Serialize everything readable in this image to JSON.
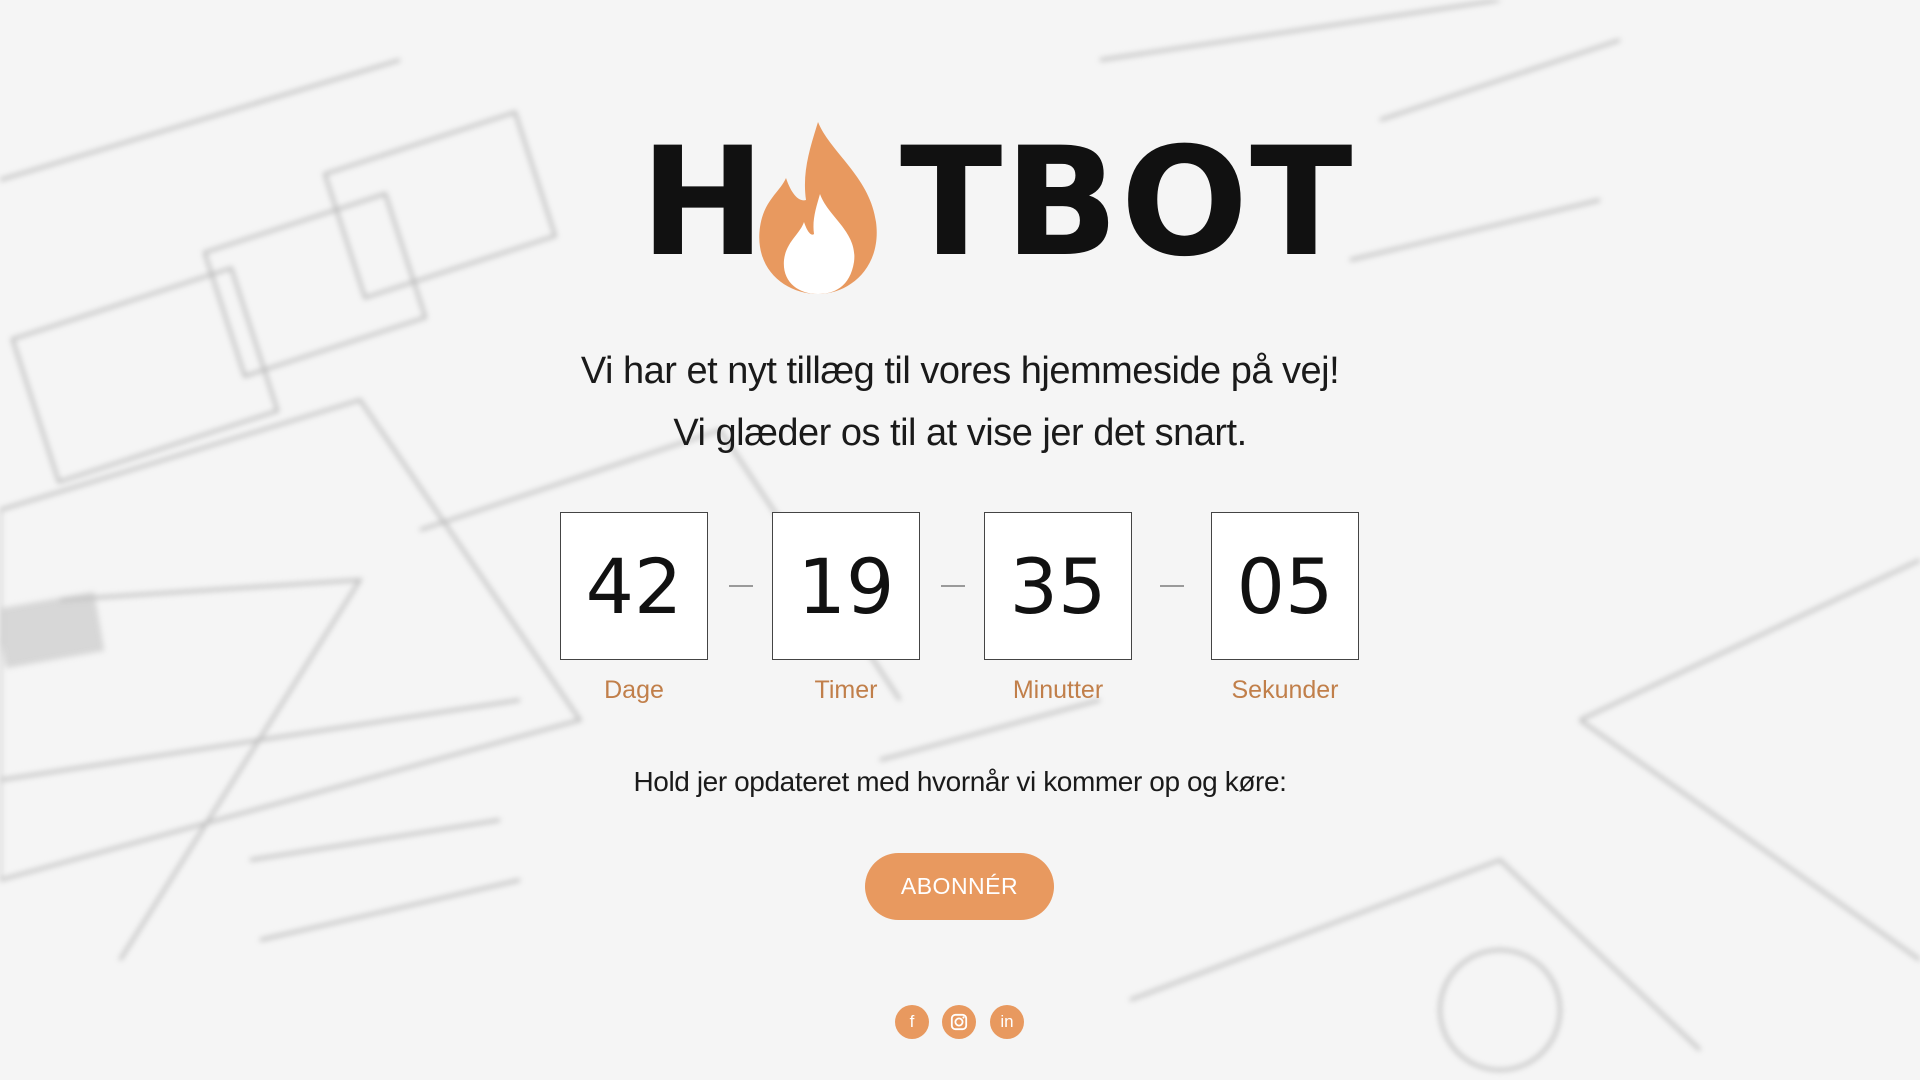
{
  "brand": {
    "logo_first": "H",
    "logo_rest": "TBOT",
    "logo_icon": "flame-icon",
    "accent_color": "#e8995f"
  },
  "headline": {
    "line1": "Vi har et nyt tillæg til vores hjemmeside på vej!",
    "line2": "Vi glæder os til at vise jer det snart."
  },
  "countdown": {
    "days": "42",
    "hours": "19",
    "minutes": "35",
    "seconds": "05",
    "days_label": "Dage",
    "hours_label": "Timer",
    "minutes_label": "Minutter",
    "seconds_label": "Sekunder"
  },
  "subscribe": {
    "prompt": "Hold jer opdateret med hvornår vi kommer op og køre:",
    "button_label": "ABONNÉR"
  },
  "social": {
    "facebook_glyph": "f",
    "linkedin_glyph": "in",
    "icons": [
      "facebook-icon",
      "instagram-icon",
      "linkedin-icon"
    ]
  }
}
